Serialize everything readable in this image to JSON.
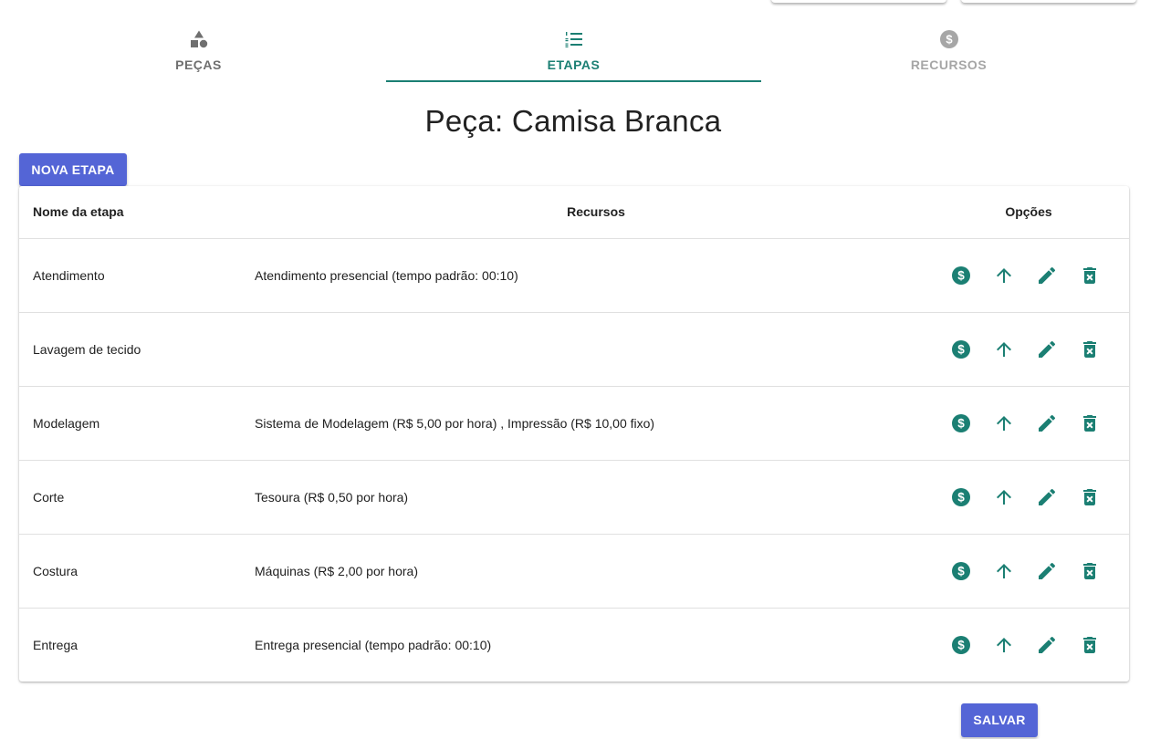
{
  "colors": {
    "accent": "#1b7f73",
    "button": "#5465d6",
    "tab_inactive": "#6f6f6f",
    "tab_disabled": "#a6a6a6"
  },
  "tabs": [
    {
      "label": "PEÇAS",
      "icon": "shapes-icon"
    },
    {
      "label": "ETAPAS",
      "icon": "numbered-list-icon",
      "active": true
    },
    {
      "label": "RECURSOS",
      "icon": "dollar-circle-icon"
    }
  ],
  "page": {
    "title": "Peça: Camisa Branca"
  },
  "actions": {
    "new_stage_label": "NOVA ETAPA",
    "save_label": "SALVAR"
  },
  "table": {
    "headers": {
      "name": "Nome da etapa",
      "resources": "Recursos",
      "options": "Opções"
    },
    "option_icons": [
      "dollar-circle-icon",
      "arrow-up-icon",
      "pencil-icon",
      "delete-icon"
    ],
    "rows": [
      {
        "name": "Atendimento",
        "resources": "Atendimento presencial (tempo padrão: 00:10)"
      },
      {
        "name": "Lavagem de tecido",
        "resources": ""
      },
      {
        "name": "Modelagem",
        "resources": "Sistema de Modelagem (R$ 5,00 por hora) , Impressão (R$ 10,00 fixo)"
      },
      {
        "name": "Corte",
        "resources": "Tesoura (R$ 0,50 por hora)"
      },
      {
        "name": "Costura",
        "resources": "Máquinas (R$ 2,00 por hora)"
      },
      {
        "name": "Entrega",
        "resources": "Entrega presencial (tempo padrão: 00:10)"
      }
    ]
  }
}
